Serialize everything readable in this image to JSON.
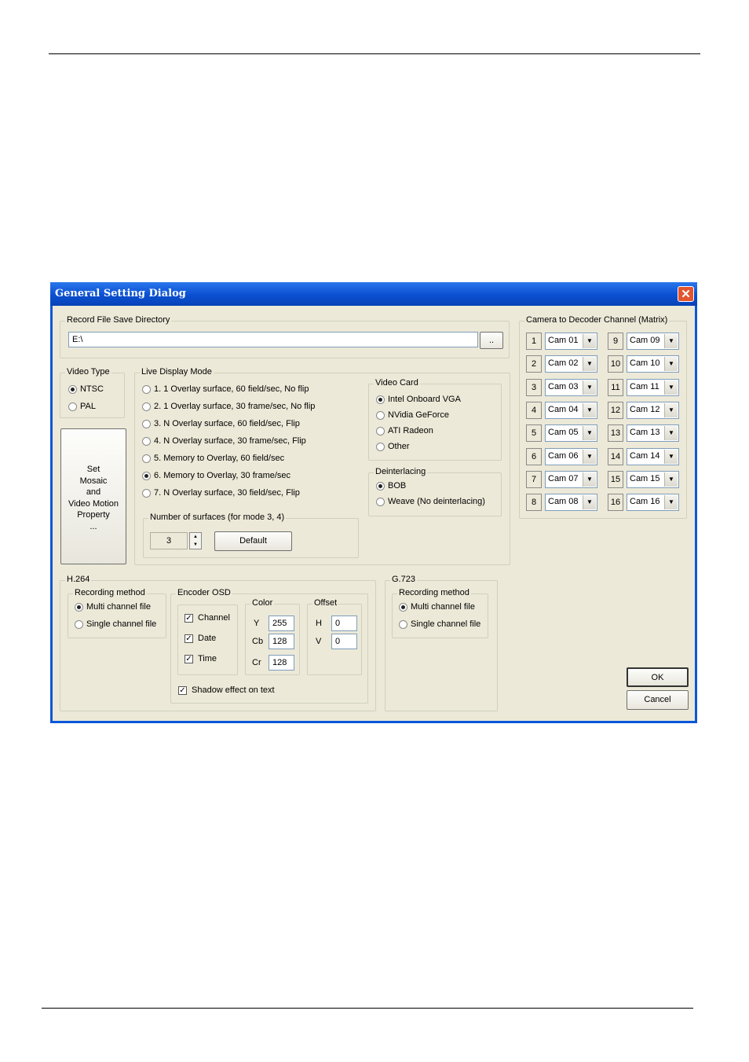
{
  "dialog": {
    "title": "General Setting Dialog",
    "close_glyph": "✕",
    "record_dir": {
      "legend": "Record File Save Directory",
      "value": "E:\\",
      "browse_label": ".."
    },
    "video_type": {
      "legend": "Video Type",
      "options": [
        "NTSC",
        "PAL"
      ],
      "selected": 0
    },
    "mosaic_button": {
      "lines": [
        "Set",
        "Mosaic",
        "and",
        "Video Motion",
        "Property",
        "..."
      ]
    },
    "live_display_mode": {
      "legend": "Live Display Mode",
      "options": [
        "1. 1 Overlay surface, 60 field/sec, No flip",
        "2. 1 Overlay surface, 30 frame/sec, No flip",
        "3. N Overlay surface, 60 field/sec, Flip",
        "4. N Overlay surface, 30 frame/sec, Flip",
        "5. Memory to Overlay, 60 field/sec",
        "6. Memory to Overlay, 30 frame/sec",
        "7. N Overlay surface, 30 field/sec, Flip"
      ],
      "selected": 5,
      "surfaces": {
        "legend": "Number of surfaces (for mode 3, 4)",
        "value": "3",
        "default_label": "Default"
      }
    },
    "video_card": {
      "legend": "Video Card",
      "options": [
        "Intel Onboard VGA",
        "NVidia GeForce",
        "ATI Radeon",
        "Other"
      ],
      "selected": 0
    },
    "deinterlacing": {
      "legend": "Deinterlacing",
      "options": [
        "BOB",
        "Weave (No deinterlacing)"
      ],
      "selected": 0
    },
    "matrix": {
      "legend": "Camera to Decoder Channel (Matrix)",
      "left": [
        {
          "num": "1",
          "cam": "Cam 01"
        },
        {
          "num": "2",
          "cam": "Cam 02"
        },
        {
          "num": "3",
          "cam": "Cam 03"
        },
        {
          "num": "4",
          "cam": "Cam 04"
        },
        {
          "num": "5",
          "cam": "Cam 05"
        },
        {
          "num": "6",
          "cam": "Cam 06"
        },
        {
          "num": "7",
          "cam": "Cam 07"
        },
        {
          "num": "8",
          "cam": "Cam 08"
        }
      ],
      "right": [
        {
          "num": "9",
          "cam": "Cam 09"
        },
        {
          "num": "10",
          "cam": "Cam 10"
        },
        {
          "num": "11",
          "cam": "Cam 11"
        },
        {
          "num": "12",
          "cam": "Cam 12"
        },
        {
          "num": "13",
          "cam": "Cam 13"
        },
        {
          "num": "14",
          "cam": "Cam 14"
        },
        {
          "num": "15",
          "cam": "Cam 15"
        },
        {
          "num": "16",
          "cam": "Cam 16"
        }
      ]
    },
    "h264": {
      "legend": "H.264",
      "recording": {
        "legend": "Recording method",
        "options": [
          "Multi channel file",
          "Single channel file"
        ],
        "selected": 0
      },
      "osd": {
        "legend": "Encoder OSD",
        "checks": [
          "Channel",
          "Date",
          "Time"
        ],
        "color": {
          "legend": "Color",
          "y_label": "Y",
          "y": "255",
          "cb_label": "Cb",
          "cb": "128",
          "cr_label": "Cr",
          "cr": "128"
        },
        "offset": {
          "legend": "Offset",
          "h_label": "H",
          "h": "0",
          "v_label": "V",
          "v": "0"
        },
        "shadow": "Shadow effect on text"
      }
    },
    "g723": {
      "legend": "G.723",
      "recording": {
        "legend": "Recording method",
        "options": [
          "Multi channel file",
          "Single channel file"
        ],
        "selected": 0
      }
    },
    "ok_label": "OK",
    "cancel_label": "Cancel",
    "check_glyph": "✓",
    "spin_up": "▲",
    "spin_down": "▼",
    "combo_arrow": "▼"
  }
}
